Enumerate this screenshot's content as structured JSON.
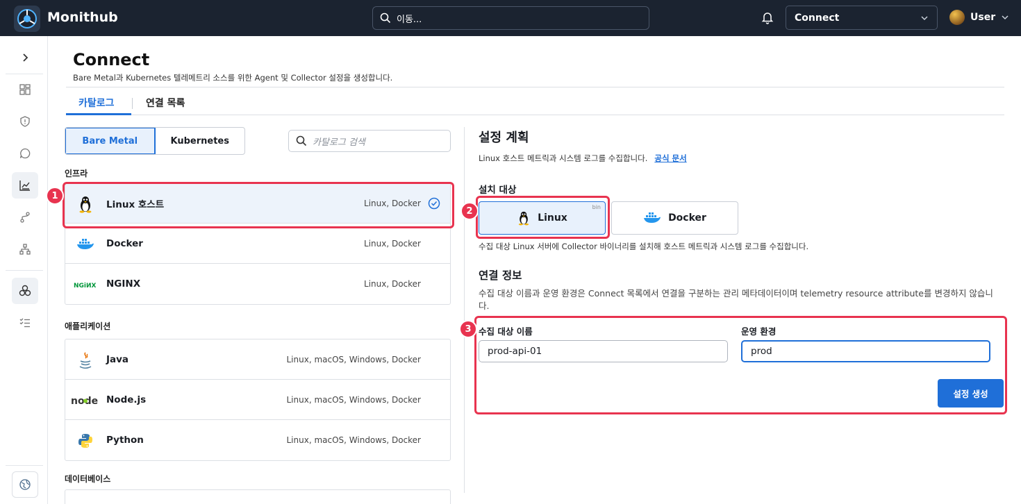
{
  "app": {
    "name": "Monithub",
    "search_placeholder": "이동...",
    "context": "Connect",
    "user": "User"
  },
  "page": {
    "title": "Connect",
    "subtitle": "Bare Metal과 Kubernetes 텔레메트리 소스를 위한 Agent 및 Collector 설정을 생성합니다.",
    "tabs": [
      {
        "label": "카탈로그"
      },
      {
        "label": "연결 목록"
      }
    ]
  },
  "catalog": {
    "env_toggle": [
      {
        "label": "Bare Metal"
      },
      {
        "label": "Kubernetes"
      }
    ],
    "search_placeholder": "카탈로그 검색",
    "groups": [
      {
        "label": "인프라",
        "items": [
          {
            "name": "Linux 호스트",
            "platforms": "Linux, Docker",
            "icon": "tux-icon"
          },
          {
            "name": "Docker",
            "platforms": "Linux, Docker",
            "icon": "docker-icon"
          },
          {
            "name": "NGINX",
            "platforms": "Linux, Docker",
            "icon": "nginx-icon"
          }
        ]
      },
      {
        "label": "애플리케이션",
        "items": [
          {
            "name": "Java",
            "platforms": "Linux, macOS, Windows, Docker",
            "icon": "java-icon"
          },
          {
            "name": "Node.js",
            "platforms": "Linux, macOS, Windows, Docker",
            "icon": "nodejs-icon"
          },
          {
            "name": "Python",
            "platforms": "Linux, macOS, Windows, Docker",
            "icon": "python-icon"
          }
        ]
      },
      {
        "label": "데이터베이스",
        "items": []
      }
    ]
  },
  "plan": {
    "title": "설정 계획",
    "description": "Linux 호스트 메트릭과 시스템 로그를 수집합니다.",
    "docs_link": "공식 문서",
    "target_label": "설치 대상",
    "targets": [
      {
        "label": "Linux",
        "badge": "bin"
      },
      {
        "label": "Docker"
      }
    ],
    "target_description": "수집 대상 Linux 서버에 Collector 바이너리를 설치해 호스트 메트릭과 시스템 로그를 수집합니다.",
    "connection_title": "연결 정보",
    "connection_description": "수집 대상 이름과 운영 환경은 Connect 목록에서 연결을 구분하는 관리 메타데이터이며 telemetry resource attribute를 변경하지 않습니다.",
    "fields": [
      {
        "label": "수집 대상 이름",
        "value": "prod-api-01"
      },
      {
        "label": "운영 환경",
        "value": "prod"
      }
    ],
    "submit_label": "설정 생성"
  },
  "annotations": [
    "1",
    "2",
    "3"
  ],
  "colors": {
    "accent": "#1f6fd8",
    "highlight": "#e8334f",
    "topbar": "#1b2330"
  }
}
